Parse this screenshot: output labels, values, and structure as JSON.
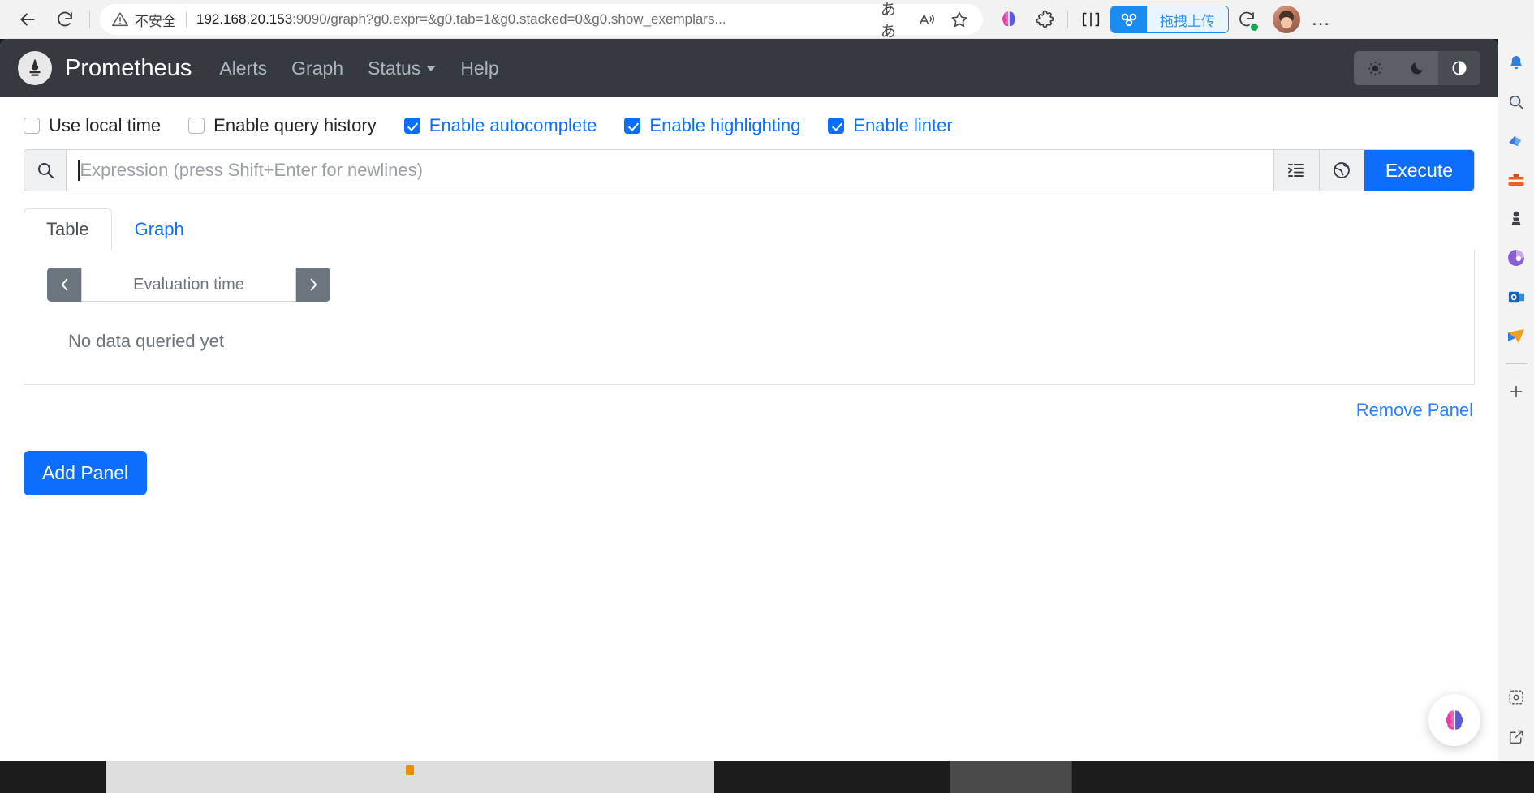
{
  "browser": {
    "back_label": "Back",
    "reload_label": "Reload",
    "security_label": "不安全",
    "url_host": "192.168.20.153",
    "url_rest": ":9090/graph?g0.expr=&g0.tab=1&g0.stacked=0&g0.show_exemplars...",
    "read_aloud_label": "Read aloud",
    "translate_label": "ああ",
    "favorite_label": "Add to favorites",
    "copilot_label": "Copilot",
    "extensions_label": "Extensions",
    "split_screen_label": "Split screen",
    "upload_button_label": "拖拽上传",
    "profile_label": "Profile",
    "settings_more_label": "…"
  },
  "prometheus": {
    "brand": "Prometheus",
    "nav": [
      {
        "label": "Alerts",
        "has_caret": false
      },
      {
        "label": "Graph",
        "has_caret": false
      },
      {
        "label": "Status",
        "has_caret": true
      },
      {
        "label": "Help",
        "has_caret": false
      }
    ],
    "theme_buttons": [
      {
        "name": "light",
        "icon": "sun-icon",
        "active": false
      },
      {
        "name": "dark",
        "icon": "moon-icon",
        "active": false
      },
      {
        "name": "auto",
        "icon": "half-circle-icon",
        "active": true
      }
    ],
    "options": [
      {
        "label": "Use local time",
        "checked": false
      },
      {
        "label": "Enable query history",
        "checked": false
      },
      {
        "label": "Enable autocomplete",
        "checked": true
      },
      {
        "label": "Enable highlighting",
        "checked": true
      },
      {
        "label": "Enable linter",
        "checked": true
      }
    ],
    "expression": {
      "value": "",
      "placeholder": "Expression (press Shift+Enter for newlines)",
      "format_label": "Format expression",
      "metrics_explorer_label": "Open metrics explorer",
      "execute_label": "Execute"
    },
    "tabs": [
      {
        "label": "Table",
        "active": true
      },
      {
        "label": "Graph",
        "active": false
      }
    ],
    "evaluation": {
      "prev_label": "‹",
      "next_label": "›",
      "placeholder": "Evaluation time",
      "value": ""
    },
    "table_empty_message": "No data queried yet",
    "remove_panel_label": "Remove Panel",
    "add_panel_label": "Add Panel"
  },
  "os_rail": {
    "items": [
      {
        "name": "notifications-icon"
      },
      {
        "name": "search-icon"
      },
      {
        "name": "onedrive-icon"
      },
      {
        "name": "toolbox-icon"
      },
      {
        "name": "chess-icon"
      },
      {
        "name": "microsoft-365-icon"
      },
      {
        "name": "outlook-icon"
      },
      {
        "name": "mail-send-icon"
      }
    ],
    "bottom_items": [
      {
        "name": "widgets-icon"
      },
      {
        "name": "external-link-icon"
      },
      {
        "name": "settings-icon"
      }
    ]
  },
  "colors": {
    "accent_blue": "#0d6efd",
    "navbar_dark": "#343a40",
    "muted_gray": "#6c757d",
    "link_blue": "#2a7fff",
    "upload_blue": "#1a8cf0"
  }
}
